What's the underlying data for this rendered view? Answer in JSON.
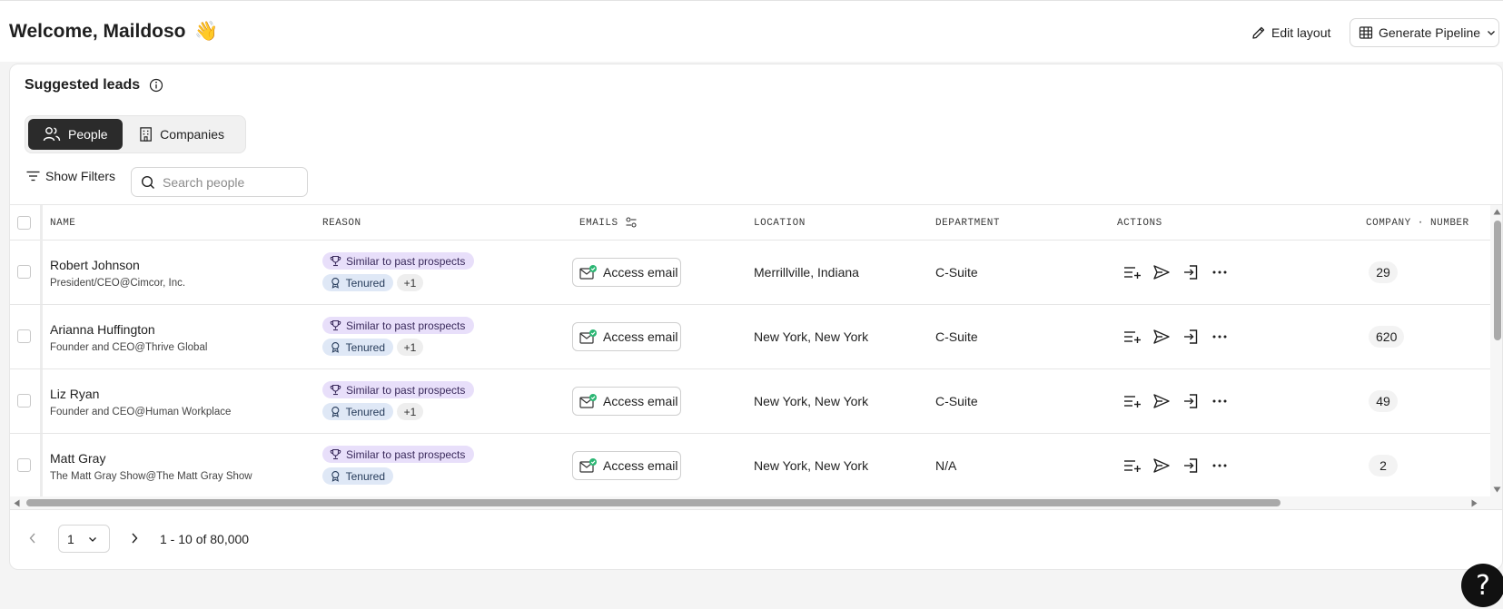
{
  "header": {
    "welcome_text": "Welcome, Maildoso",
    "welcome_emoji": "👋",
    "edit_layout_label": "Edit layout",
    "generate_pipeline_label": "Generate Pipeline"
  },
  "card": {
    "title": "Suggested leads",
    "segments": [
      {
        "label": "People",
        "active": true
      },
      {
        "label": "Companies",
        "active": false
      }
    ],
    "show_filters_label": "Show Filters",
    "search": {
      "placeholder": "Search people",
      "value": ""
    }
  },
  "table": {
    "columns": [
      "NAME",
      "REASON",
      "EMAILS",
      "LOCATION",
      "DEPARTMENT",
      "ACTIONS",
      "COMPANY · NUMBER"
    ],
    "rows": [
      {
        "name": "Robert Johnson",
        "title": "President/CEO@Cimcor, Inc.",
        "reason_primary": "Similar to past prospects",
        "reason_secondary": "Tenured",
        "reason_more": "+1",
        "email_button": "Access email",
        "location": "Merrillville, Indiana",
        "department": "C-Suite",
        "company_number": "29"
      },
      {
        "name": "Arianna Huffington",
        "title": "Founder and CEO@Thrive Global",
        "reason_primary": "Similar to past prospects",
        "reason_secondary": "Tenured",
        "reason_more": "+1",
        "email_button": "Access email",
        "location": "New York, New York",
        "department": "C-Suite",
        "company_number": "620"
      },
      {
        "name": "Liz Ryan",
        "title": "Founder and CEO@Human Workplace",
        "reason_primary": "Similar to past prospects",
        "reason_secondary": "Tenured",
        "reason_more": "+1",
        "email_button": "Access email",
        "location": "New York, New York",
        "department": "C-Suite",
        "company_number": "49"
      },
      {
        "name": "Matt Gray",
        "title": "The Matt Gray Show@The Matt Gray Show",
        "reason_primary": "Similar to past prospects",
        "reason_secondary": "Tenured",
        "reason_more": "",
        "email_button": "Access email",
        "location": "New York, New York",
        "department": "N/A",
        "company_number": "2"
      }
    ]
  },
  "pagination": {
    "current_page": "1",
    "range_text": "1 - 10 of 80,000"
  },
  "help_label": "?",
  "icons": {
    "edit": "pencil-icon",
    "pipeline": "table-grid-icon",
    "info": "info-icon",
    "people": "people-icon",
    "companies": "building-icon",
    "filter": "filter-icon",
    "search": "search-icon",
    "email_status": "email-check-icon",
    "actions": [
      "add-to-list-icon",
      "send-icon",
      "export-icon",
      "more-icon"
    ]
  },
  "colors": {
    "primary_dark": "#2b2b2b",
    "reason_purple_bg": "#e8dffa",
    "reason_blue_bg": "#dfe8f6",
    "email_check_green": "#2bb673"
  }
}
